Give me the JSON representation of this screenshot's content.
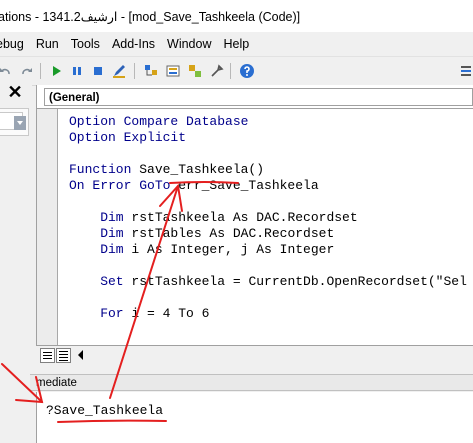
{
  "window": {
    "title": "ations - 1341.2ارشيف - [mod_Save_Tashkeela (Code)]"
  },
  "menu": {
    "items": [
      "ebug",
      "Run",
      "Tools",
      "Add-Ins",
      "Window",
      "Help"
    ]
  },
  "toolbar": {
    "icons": [
      "undo-icon",
      "redo-icon",
      "run-icon",
      "break-icon",
      "reset-icon",
      "design-mode-icon",
      "project-explorer-icon",
      "properties-icon",
      "object-browser-icon",
      "toolbox-icon",
      "help-icon",
      "toolbar-options-icon"
    ]
  },
  "left_pane": {
    "close_glyph": "✕"
  },
  "code_window": {
    "object_dropdown": "(General)",
    "lines": [
      {
        "kw": "Option Compare Database",
        "tx": ""
      },
      {
        "kw": "Option Explicit",
        "tx": ""
      },
      {
        "kw": "",
        "tx": ""
      },
      {
        "kw": "Function ",
        "tx": "Save_Tashkeela()"
      },
      {
        "kw": "On Error GoTo ",
        "tx": "err_Save_Tashkeela"
      },
      {
        "kw": "",
        "tx": ""
      },
      {
        "kw": "    Dim ",
        "tx": "rstTashkeela As DAC.Recordset"
      },
      {
        "kw": "    Dim ",
        "tx": "rstTables As DAC.Recordset"
      },
      {
        "kw": "    Dim ",
        "tx": "i As Integer, j As Integer"
      },
      {
        "kw": "",
        "tx": ""
      },
      {
        "kw": "    Set ",
        "tx": "rstTashkeela = CurrentDb.OpenRecordset(\"Sel"
      },
      {
        "kw": "",
        "tx": ""
      },
      {
        "kw": "    For ",
        "tx": "i = 4 To 6"
      }
    ]
  },
  "immediate": {
    "title": "mediate",
    "command": "?Save_Tashkeela"
  },
  "colors": {
    "keyword": "#00008b",
    "annotation": "#e41f1f"
  }
}
